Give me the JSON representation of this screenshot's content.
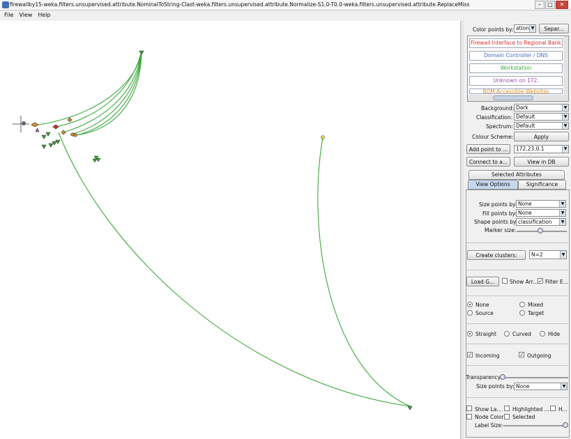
{
  "window": {
    "title": "firewallby15-weka.filters.unsupervised.attribute.NominalToString-Clast-weka.filters.unsupervised.attribute.Normalize-S1.0-T0.0-weka.filters.unsupervised.attribute.ReplaceMissingValues",
    "minimize": "–",
    "maximize": "□",
    "close": "✕"
  },
  "menu": [
    "File",
    "View",
    "Help"
  ],
  "panel": {
    "color_points_label": "Color points by:",
    "color_points_value": "ation",
    "separate_button": "Separ...",
    "legend": [
      {
        "label": "Firewall interface to Regional Bank",
        "color": "#d32f2f"
      },
      {
        "label": "Domain Controller / DNS",
        "color": "#3f6fbf"
      },
      {
        "label": "Workstation",
        "color": "#3aa83a"
      },
      {
        "label": "Unknown on 172.",
        "color": "#a04ab0"
      },
      {
        "label": "BOM Accessible Websites",
        "color": "#e0902a"
      }
    ],
    "background_label": "Background:",
    "background_value": "Dark",
    "classification_label": "Classification:",
    "classification_value": "Default",
    "spectrum_label": "Spectrum:",
    "spectrum_value": "Default",
    "colour_scheme_label": "Colour Scheme:",
    "apply_button": "Apply",
    "add_point_button": "Add point to ...",
    "add_point_value": "172.23.0.1",
    "connect_button": "Connect to a...",
    "view_db_button": "View in DB",
    "tabs": {
      "selected_attributes": "Selected Attributes",
      "view_options": "View Options",
      "significance": "Significance"
    },
    "size_points_label": "Size points by:",
    "size_points_value": "None",
    "fill_points_label": "Fill points by:",
    "fill_points_value": "None",
    "shape_points_label": "Shape points by:",
    "shape_points_value": "classification",
    "marker_size_label": "Marker size:",
    "create_clusters_button": "Create clusters:",
    "clusters_value": "N=2",
    "load_button": "Load G...",
    "show_arrows_label": "Show Arr...",
    "filter_label": "Filter E...",
    "radio_none": "None",
    "radio_mixed": "Mixed",
    "radio_source": "Source",
    "radio_target": "Target",
    "radio_straight": "Straight",
    "radio_curved": "Curved",
    "radio_hide": "Hide",
    "incoming_label": "Incoming",
    "outgoing_label": "Outgoing",
    "transparency_label": "Transparency:",
    "size_points2_label": "Size points by:",
    "size_points2_value": "None",
    "show_labels_label": "Show La...",
    "highlighted_label": "Highlighted ...",
    "h_label": "H...",
    "node_color_label": "Node Color",
    "selected_label": "Selected",
    "label_size_label": "Label Size:",
    "checkmark": "✓"
  },
  "colors": {
    "edge": "#3aa83a",
    "accent": "#c7d8ee"
  }
}
